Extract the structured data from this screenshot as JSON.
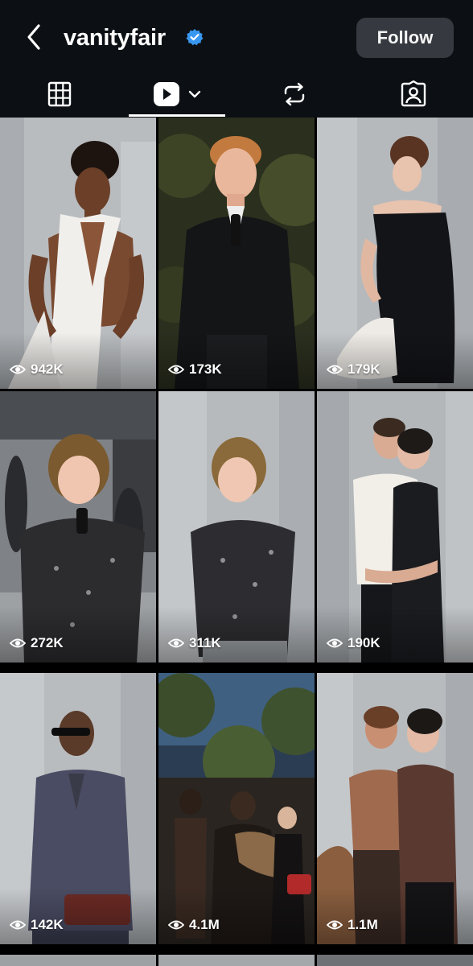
{
  "profile": {
    "username": "vanityfair",
    "verified": true,
    "follow_label": "Follow"
  },
  "tabs": [
    {
      "name": "grid",
      "icon": "grid-icon"
    },
    {
      "name": "reels",
      "icon": "reels-icon",
      "selected": true
    },
    {
      "name": "reposts",
      "icon": "repost-icon"
    },
    {
      "name": "tagged",
      "icon": "tagged-icon"
    }
  ],
  "colors": {
    "header_bg": "#0c1014",
    "follow_bg": "#363a40",
    "verified_blue": "#3897f0"
  },
  "reels": [
    {
      "views": "942K"
    },
    {
      "views": "173K"
    },
    {
      "views": "179K"
    },
    {
      "views": "272K"
    },
    {
      "views": "311K"
    },
    {
      "views": "190K"
    },
    {
      "views": "142K"
    },
    {
      "views": "4.1M"
    },
    {
      "views": "1.1M"
    }
  ]
}
